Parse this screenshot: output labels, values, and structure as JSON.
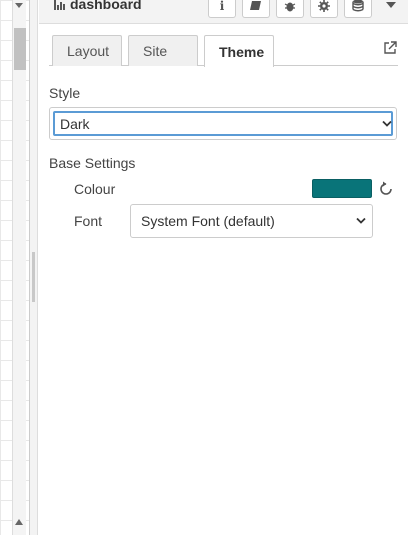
{
  "header": {
    "title": "dashboard",
    "buttons": [
      {
        "name": "info-icon",
        "glyph": "ℹ"
      },
      {
        "name": "book-icon",
        "glyph": "📖"
      },
      {
        "name": "bug-icon",
        "glyph": "🐞"
      },
      {
        "name": "gear-icon",
        "glyph": "⚙"
      },
      {
        "name": "database-icon",
        "glyph": "🛢"
      }
    ]
  },
  "tabs": [
    {
      "label": "Layout",
      "active": false
    },
    {
      "label": "Site",
      "active": false
    },
    {
      "label": "Theme",
      "active": true
    }
  ],
  "style": {
    "label": "Style",
    "value": "Dark"
  },
  "base_settings": {
    "label": "Base Settings",
    "colour_label": "Colour",
    "colour_value": "#097479",
    "font_label": "Font",
    "font_value": "System Font (default)"
  }
}
